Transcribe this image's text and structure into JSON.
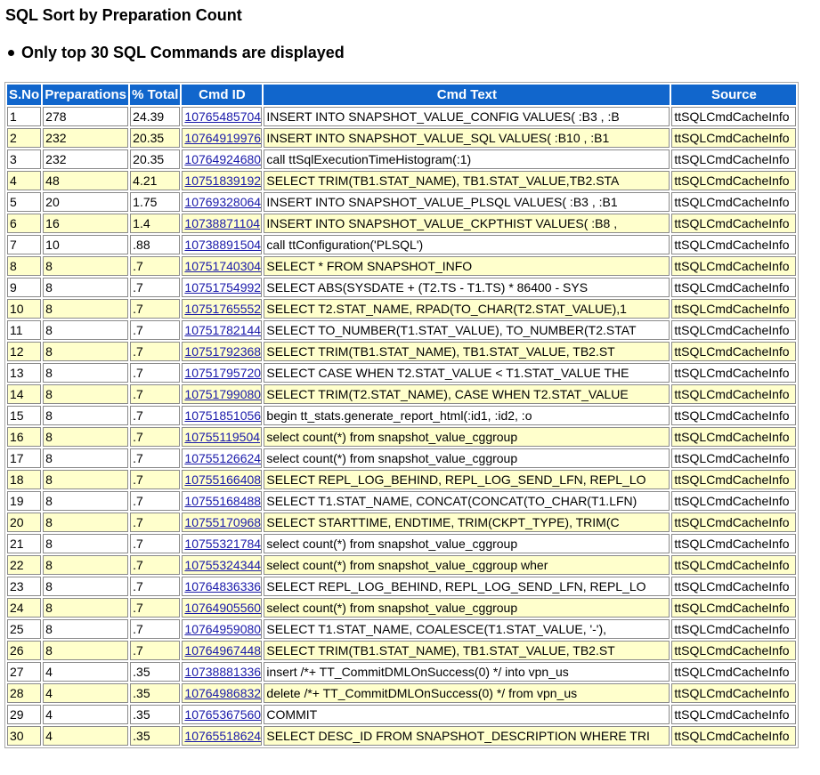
{
  "title": "SQL Sort by Preparation Count",
  "note": "Only top 30 SQL Commands are displayed",
  "colors": {
    "header_bg": "#1166cc",
    "header_text": "#ffffff",
    "alt_row_bg": "#ffffcc",
    "link": "#1a1aaa"
  },
  "table": {
    "headers": [
      "S.No",
      "Preparations",
      "% Total",
      "Cmd ID",
      "Cmd Text",
      "Source"
    ],
    "rows": [
      [
        "1",
        "278",
        "24.39",
        "10765485704",
        "INSERT INTO SNAPSHOT_VALUE_CONFIG VALUES( :B3 , :B",
        "ttSQLCmdCacheInfo"
      ],
      [
        "2",
        "232",
        "20.35",
        "10764919976",
        "INSERT INTO SNAPSHOT_VALUE_SQL VALUES( :B10 , :B1",
        "ttSQLCmdCacheInfo"
      ],
      [
        "3",
        "232",
        "20.35",
        "10764924680",
        "call ttSqlExecutionTimeHistogram(:1)",
        "ttSQLCmdCacheInfo"
      ],
      [
        "4",
        "48",
        "4.21",
        "10751839192",
        "SELECT TRIM(TB1.STAT_NAME), TB1.STAT_VALUE,TB2.STA",
        "ttSQLCmdCacheInfo"
      ],
      [
        "5",
        "20",
        "1.75",
        "10769328064",
        "INSERT INTO SNAPSHOT_VALUE_PLSQL VALUES( :B3 , :B1",
        "ttSQLCmdCacheInfo"
      ],
      [
        "6",
        "16",
        "1.4",
        "10738871104",
        "INSERT INTO SNAPSHOT_VALUE_CKPTHIST VALUES( :B8 ,",
        "ttSQLCmdCacheInfo"
      ],
      [
        "7",
        "10",
        ".88",
        "10738891504",
        "call ttConfiguration('PLSQL')",
        "ttSQLCmdCacheInfo"
      ],
      [
        "8",
        "8",
        ".7",
        "10751740304",
        "SELECT * FROM SNAPSHOT_INFO",
        "ttSQLCmdCacheInfo"
      ],
      [
        "9",
        "8",
        ".7",
        "10751754992",
        "SELECT ABS(SYSDATE + (T2.TS - T1.TS) * 86400 - SYS",
        "ttSQLCmdCacheInfo"
      ],
      [
        "10",
        "8",
        ".7",
        "10751765552",
        "SELECT T2.STAT_NAME, RPAD(TO_CHAR(T2.STAT_VALUE),1",
        "ttSQLCmdCacheInfo"
      ],
      [
        "11",
        "8",
        ".7",
        "10751782144",
        "SELECT TO_NUMBER(T1.STAT_VALUE), TO_NUMBER(T2.STAT",
        "ttSQLCmdCacheInfo"
      ],
      [
        "12",
        "8",
        ".7",
        "10751792368",
        "SELECT TRIM(TB1.STAT_NAME), TB1.STAT_VALUE, TB2.ST",
        "ttSQLCmdCacheInfo"
      ],
      [
        "13",
        "8",
        ".7",
        "10751795720",
        "SELECT CASE WHEN T2.STAT_VALUE < T1.STAT_VALUE THE",
        "ttSQLCmdCacheInfo"
      ],
      [
        "14",
        "8",
        ".7",
        "10751799080",
        "SELECT TRIM(T2.STAT_NAME), CASE WHEN T2.STAT_VALUE",
        "ttSQLCmdCacheInfo"
      ],
      [
        "15",
        "8",
        ".7",
        "10751851056",
        "begin tt_stats.generate_report_html(:id1, :id2, :o",
        "ttSQLCmdCacheInfo"
      ],
      [
        "16",
        "8",
        ".7",
        "10755119504",
        "select count(*) from snapshot_value_cggroup",
        "ttSQLCmdCacheInfo"
      ],
      [
        "17",
        "8",
        ".7",
        "10755126624",
        "select count(*) from snapshot_value_cggroup",
        "ttSQLCmdCacheInfo"
      ],
      [
        "18",
        "8",
        ".7",
        "10755166408",
        "SELECT REPL_LOG_BEHIND, REPL_LOG_SEND_LFN, REPL_LO",
        "ttSQLCmdCacheInfo"
      ],
      [
        "19",
        "8",
        ".7",
        "10755168488",
        "SELECT T1.STAT_NAME, CONCAT(CONCAT(TO_CHAR(T1.LFN)",
        "ttSQLCmdCacheInfo"
      ],
      [
        "20",
        "8",
        ".7",
        "10755170968",
        "SELECT STARTTIME, ENDTIME, TRIM(CKPT_TYPE), TRIM(C",
        "ttSQLCmdCacheInfo"
      ],
      [
        "21",
        "8",
        ".7",
        "10755321784",
        "select count(*) from snapshot_value_cggroup",
        "ttSQLCmdCacheInfo"
      ],
      [
        "22",
        "8",
        ".7",
        "10755324344",
        "select count(*) from snapshot_value_cggroup wher",
        "ttSQLCmdCacheInfo"
      ],
      [
        "23",
        "8",
        ".7",
        "10764836336",
        "SELECT REPL_LOG_BEHIND, REPL_LOG_SEND_LFN, REPL_LO",
        "ttSQLCmdCacheInfo"
      ],
      [
        "24",
        "8",
        ".7",
        "10764905560",
        "select count(*) from snapshot_value_cggroup",
        "ttSQLCmdCacheInfo"
      ],
      [
        "25",
        "8",
        ".7",
        "10764959080",
        "SELECT T1.STAT_NAME, COALESCE(T1.STAT_VALUE, '-'),",
        "ttSQLCmdCacheInfo"
      ],
      [
        "26",
        "8",
        ".7",
        "10764967448",
        "SELECT TRIM(TB1.STAT_NAME), TB1.STAT_VALUE, TB2.ST",
        "ttSQLCmdCacheInfo"
      ],
      [
        "27",
        "4",
        ".35",
        "10738881336",
        "insert /*+ TT_CommitDMLOnSuccess(0) */ into vpn_us",
        "ttSQLCmdCacheInfo"
      ],
      [
        "28",
        "4",
        ".35",
        "10764986832",
        "delete /*+ TT_CommitDMLOnSuccess(0) */ from vpn_us",
        "ttSQLCmdCacheInfo"
      ],
      [
        "29",
        "4",
        ".35",
        "10765367560",
        "COMMIT",
        "ttSQLCmdCacheInfo"
      ],
      [
        "30",
        "4",
        ".35",
        "10765518624",
        "SELECT DESC_ID FROM SNAPSHOT_DESCRIPTION WHERE TRI",
        "ttSQLCmdCacheInfo"
      ]
    ]
  }
}
